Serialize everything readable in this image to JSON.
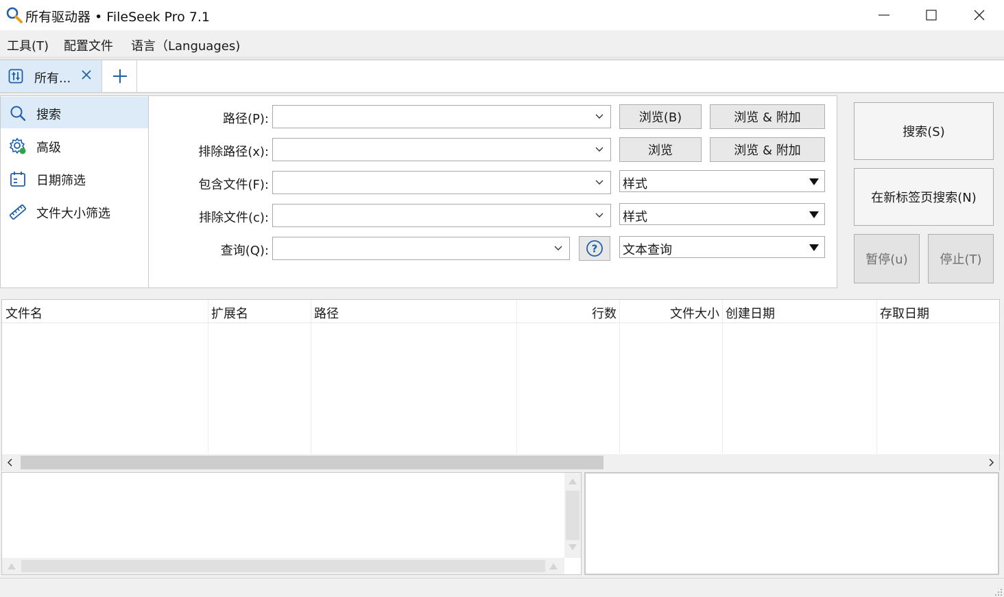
{
  "window": {
    "title": "所有驱动器 • FileSeek Pro 7.1",
    "controls": [
      "minimize",
      "maximize",
      "close"
    ]
  },
  "menu": {
    "items": [
      "工具(T)",
      "配置文件",
      "语言（Languages)"
    ]
  },
  "tabs": {
    "items": [
      {
        "label": "所有...",
        "icon": "sliders-icon"
      }
    ],
    "add_icon": "plus-icon"
  },
  "sidebar": {
    "items": [
      {
        "label": "搜索",
        "icon": "search-icon",
        "active": true
      },
      {
        "label": "高级",
        "icon": "gear-icon"
      },
      {
        "label": "日期筛选",
        "icon": "calendar-icon"
      },
      {
        "label": "文件大小筛选",
        "icon": "ruler-icon"
      }
    ]
  },
  "form": {
    "path_label": "路径(P):",
    "path_value": "",
    "browse_label": "浏览(B)",
    "browse_append_label": "浏览 & 附加",
    "exclude_path_label": "排除路径(x):",
    "exclude_path_value": "",
    "browse2_label": "浏览",
    "browse_append2_label": "浏览 & 附加",
    "include_files_label": "包含文件(F):",
    "include_files_value": "",
    "include_mode": "样式",
    "exclude_files_label": "排除文件(c):",
    "exclude_files_value": "",
    "exclude_mode": "样式",
    "query_label": "查询(Q):",
    "query_value": "",
    "query_mode": "文本查询",
    "help_icon": "help-circle-icon"
  },
  "actions": {
    "search": "搜索(S)",
    "search_new_tab": "在新标签页搜索(N)",
    "pause": "暂停(u)",
    "stop": "停止(T)"
  },
  "results": {
    "columns": [
      "文件名",
      "扩展名",
      "路径",
      "行数",
      "文件大小",
      "创建日期",
      "存取日期"
    ],
    "rows": []
  },
  "colors": {
    "accent": "#1f5fa8",
    "selected_bg": "#dcebf7",
    "status_dot": "#27a844"
  }
}
